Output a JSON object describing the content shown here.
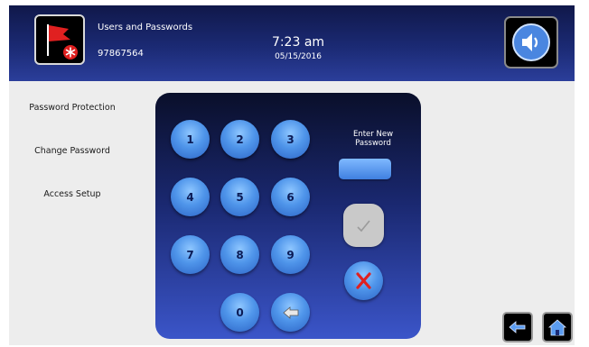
{
  "header": {
    "title": "Users and Passwords",
    "id": "97867564",
    "time": "7:23 am",
    "date": "05/15/2016",
    "logo_icon": "red-flag-icon",
    "sound_icon": "speaker-icon"
  },
  "menu": {
    "items": [
      {
        "label": "Password Protection"
      },
      {
        "label": "Change Password"
      },
      {
        "label": "Access Setup"
      }
    ]
  },
  "keypad": {
    "keys": [
      "1",
      "2",
      "3",
      "4",
      "5",
      "6",
      "7",
      "8",
      "9",
      "0"
    ],
    "backspace_icon": "backspace-arrow-icon",
    "prompt": "Enter New Password",
    "password_value": "",
    "confirm_icon": "checkmark-icon",
    "cancel_icon": "red-x-icon"
  },
  "footer": {
    "back_icon": "back-arrow-icon",
    "home_icon": "home-icon"
  },
  "colors": {
    "header_dark": "#10184a",
    "header_light": "#2b3e9a",
    "key_blue": "#4f95ea",
    "accent_red": "#e02020"
  }
}
